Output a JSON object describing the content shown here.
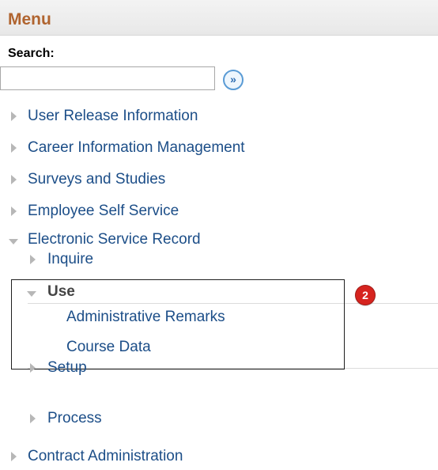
{
  "header": {
    "title": "Menu"
  },
  "search": {
    "label": "Search:",
    "value": "",
    "go_icon": "double-chevron-right-icon"
  },
  "menu": {
    "user_release": "User Release Information",
    "career_info": "Career Information Management",
    "surveys": "Surveys and Studies",
    "employee_self_service": "Employee Self Service",
    "electronic_service_record": "Electronic Service Record",
    "inquire": "Inquire",
    "use": "Use",
    "administrative_remarks": "Administrative Remarks",
    "course_data": "Course Data",
    "setup": "Setup",
    "process": "Process",
    "contract_admin": "Contract Administration"
  },
  "callout": {
    "step": "2",
    "color": "#d6241f"
  },
  "colors": {
    "link": "#1c4e88",
    "header_title": "#b0642f"
  }
}
